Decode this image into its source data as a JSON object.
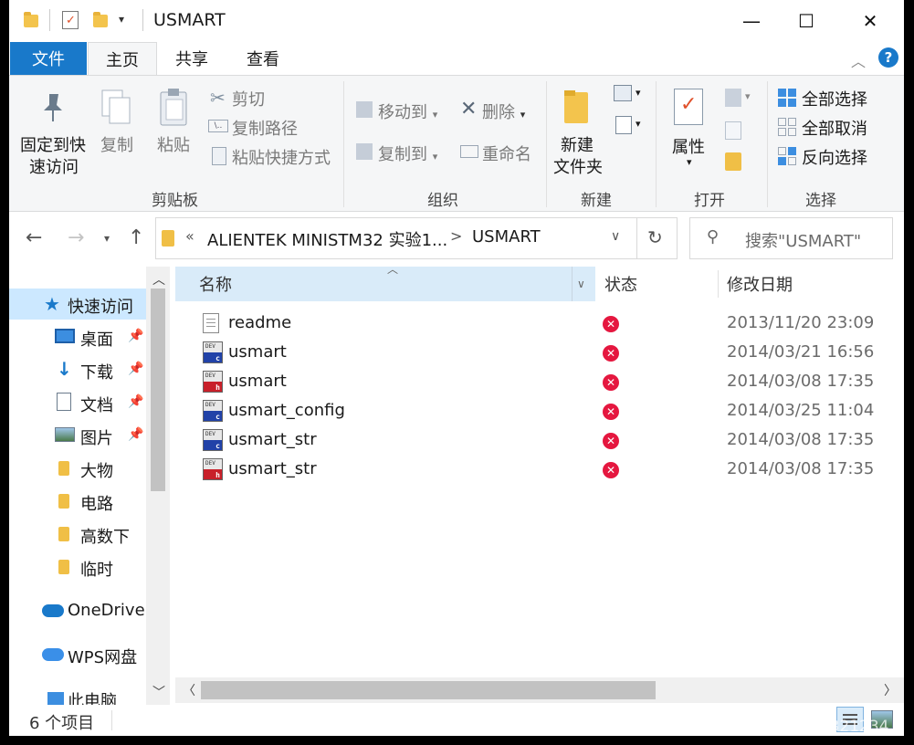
{
  "window": {
    "title": "USMART",
    "minimize": "—",
    "maximize": "☐",
    "close": "✕"
  },
  "ribbon_tabs": [
    {
      "label": "文件"
    },
    {
      "label": "主页"
    },
    {
      "label": "共享"
    },
    {
      "label": "查看"
    }
  ],
  "ribbon": {
    "clipboard": {
      "pin_label_1": "固定到快",
      "pin_label_2": "速访问",
      "copy": "复制",
      "paste": "粘贴",
      "cut": "剪切",
      "copy_path": "复制路径",
      "paste_shortcut": "粘贴快捷方式",
      "group": "剪贴板"
    },
    "organize": {
      "move_to": "移动到",
      "copy_to": "复制到",
      "delete": "删除",
      "rename": "重命名",
      "group": "组织"
    },
    "new": {
      "new_folder_1": "新建",
      "new_folder_2": "文件夹",
      "group": "新建"
    },
    "open": {
      "properties": "属性",
      "group": "打开"
    },
    "select": {
      "select_all": "全部选择",
      "select_none": "全部取消",
      "invert": "反向选择",
      "group": "选择"
    }
  },
  "address": {
    "chevron": "«",
    "crumb1": "ALIENTEK MINISTM32 实验1...",
    "separator": ">",
    "crumb2": "USMART",
    "search_placeholder": "搜索\"USMART\""
  },
  "nav": [
    {
      "label": "快速访问",
      "icon": "star-icon"
    },
    {
      "label": "桌面",
      "icon": "desktop-icon"
    },
    {
      "label": "下载",
      "icon": "download-icon"
    },
    {
      "label": "文档",
      "icon": "document-icon"
    },
    {
      "label": "图片",
      "icon": "picture-icon"
    },
    {
      "label": "大物",
      "icon": "folder-icon"
    },
    {
      "label": "电路",
      "icon": "folder-icon"
    },
    {
      "label": "高数下",
      "icon": "folder-icon"
    },
    {
      "label": "临时",
      "icon": "folder-icon"
    },
    {
      "label": "OneDrive",
      "icon": "cloud-icon"
    },
    {
      "label": "WPS网盘",
      "icon": "cloud-icon"
    },
    {
      "label": "此电脑",
      "icon": "computer-icon"
    }
  ],
  "columns": {
    "name": "名称",
    "status": "状态",
    "modified": "修改日期"
  },
  "files": [
    {
      "name": "readme",
      "type": "txt",
      "date": "2013/11/20 23:09"
    },
    {
      "name": "usmart",
      "type": "c",
      "date": "2014/03/21 16:56"
    },
    {
      "name": "usmart",
      "type": "h",
      "date": "2014/03/08 17:35"
    },
    {
      "name": "usmart_config",
      "type": "c",
      "date": "2014/03/25 11:04"
    },
    {
      "name": "usmart_str",
      "type": "c",
      "date": "2014/03/08 17:35"
    },
    {
      "name": "usmart_str",
      "type": "h",
      "date": "2014/03/08 17:35"
    }
  ],
  "status_bar": {
    "count": "6 个项目"
  },
  "watermark": "CSDN @qq_39321234"
}
